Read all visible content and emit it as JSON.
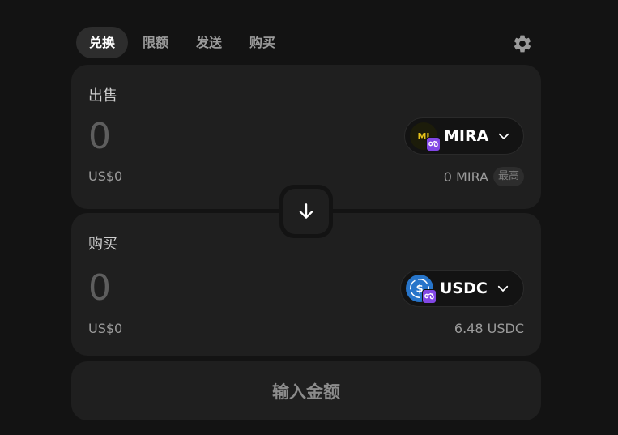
{
  "tabs": [
    {
      "label": "兑换",
      "active": true
    },
    {
      "label": "限额",
      "active": false
    },
    {
      "label": "发送",
      "active": false
    },
    {
      "label": "购买",
      "active": false
    }
  ],
  "sell": {
    "label": "出售",
    "amount_placeholder": "0",
    "fiat_value": "US$0",
    "token": {
      "symbol": "MIRA",
      "logo_text": "MI",
      "icon": "mira-token-icon",
      "chain_icon": "polygon-chain-icon"
    },
    "balance": "0 MIRA",
    "max_label": "最高"
  },
  "buy": {
    "label": "购买",
    "amount_placeholder": "0",
    "fiat_value": "US$0",
    "token": {
      "symbol": "USDC",
      "icon": "usdc-token-icon",
      "chain_icon": "polygon-chain-icon"
    },
    "balance": "6.48 USDC"
  },
  "switch_icon": "arrow-down-icon",
  "settings_icon": "gear-icon",
  "cta_label": "输入金额",
  "colors": {
    "background": "#131313",
    "panel": "#1f1f1f",
    "active_tab": "#2d2d2d",
    "polygon": "#8247e5",
    "usdc": "#2775ca"
  }
}
